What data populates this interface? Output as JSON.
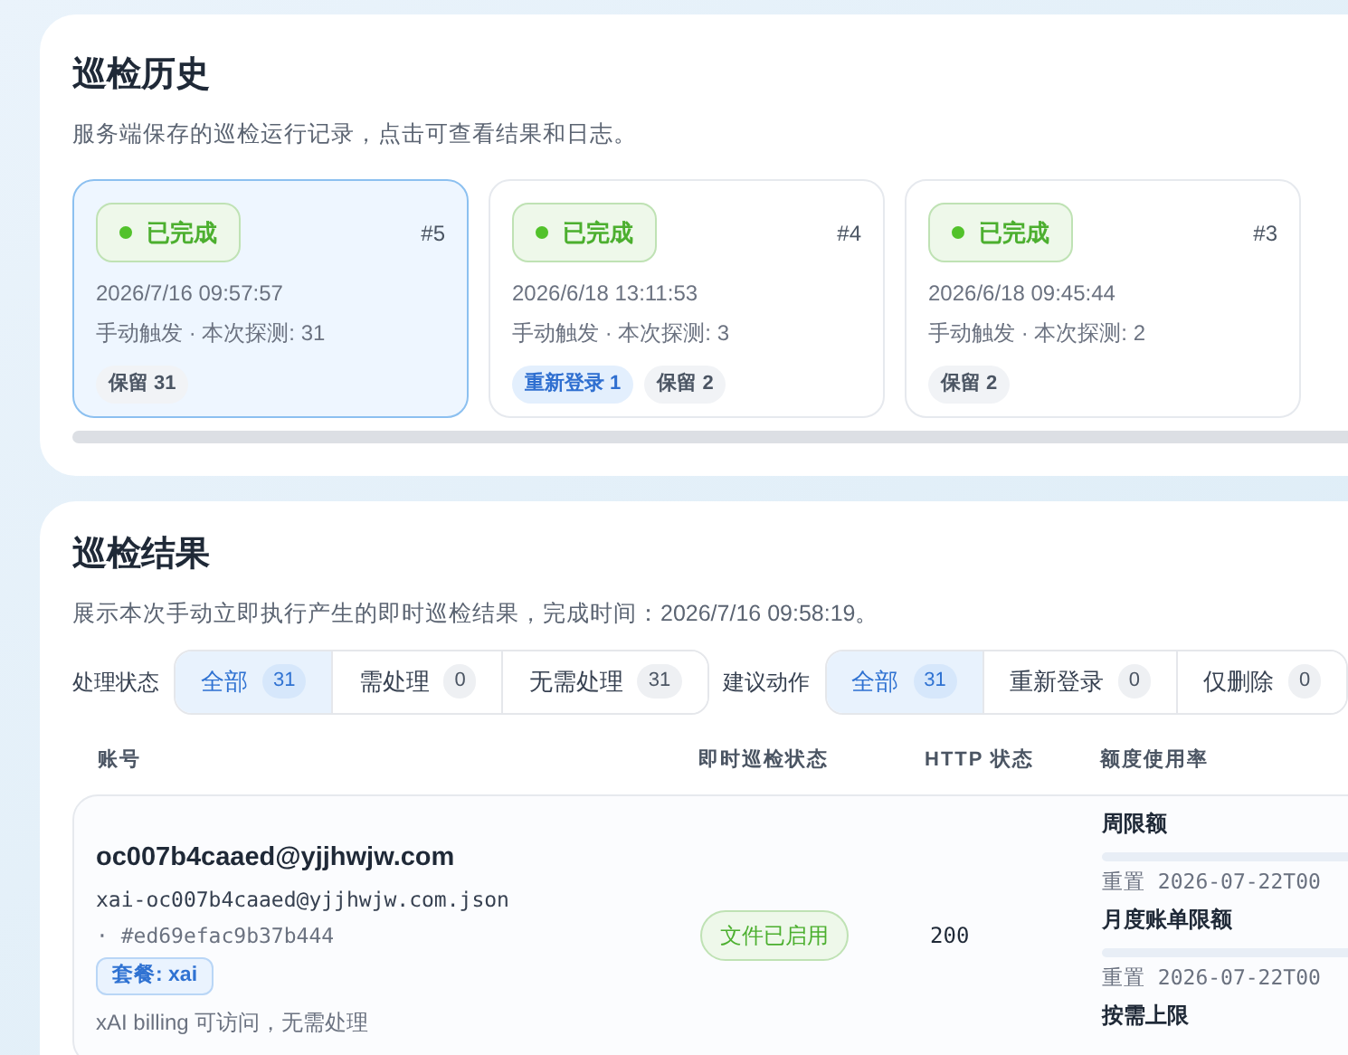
{
  "history": {
    "title": "巡检历史",
    "subtitle": "服务端保存的巡检运行记录，点击可查看结果和日志。",
    "runs": [
      {
        "status": "已完成",
        "number": "#5",
        "time": "2026/7/16 09:57:57",
        "summary": "手动触发 · 本次探测: 31",
        "selected": true,
        "tags": [
          {
            "kind": "keep",
            "label": "保留 31"
          }
        ]
      },
      {
        "status": "已完成",
        "number": "#4",
        "time": "2026/6/18 13:11:53",
        "summary": "手动触发 · 本次探测: 3",
        "selected": false,
        "tags": [
          {
            "kind": "relogin",
            "label": "重新登录 1"
          },
          {
            "kind": "keep",
            "label": "保留 2"
          }
        ]
      },
      {
        "status": "已完成",
        "number": "#3",
        "time": "2026/6/18 09:45:44",
        "summary": "手动触发 · 本次探测: 2",
        "selected": false,
        "tags": [
          {
            "kind": "keep",
            "label": "保留 2"
          }
        ]
      }
    ]
  },
  "results": {
    "title": "巡检结果",
    "subtitle": "展示本次手动立即执行产生的即时巡检结果，完成时间：2026/7/16 09:58:19。",
    "filters": [
      {
        "label": "处理状态",
        "options": [
          {
            "label": "全部",
            "count": "31",
            "selected": true
          },
          {
            "label": "需处理",
            "count": "0",
            "selected": false
          },
          {
            "label": "无需处理",
            "count": "31",
            "selected": false
          }
        ]
      },
      {
        "label": "建议动作",
        "options": [
          {
            "label": "全部",
            "count": "31",
            "selected": true
          },
          {
            "label": "重新登录",
            "count": "0",
            "selected": false
          },
          {
            "label": "仅删除",
            "count": "0",
            "selected": false
          }
        ]
      }
    ],
    "columns": [
      "账号",
      "即时巡检状态",
      "HTTP 状态",
      "额度使用率"
    ],
    "rows": [
      {
        "email": "oc007b4caaed@yjjhwjw.com",
        "file": "xai-oc007b4caaed@yjjhwjw.com.json",
        "hash": "· #ed69efac9b37b444",
        "plan": "套餐: xai",
        "note": "xAI billing 可访问，无需处理",
        "status": "文件已启用",
        "http": "200",
        "quotas": [
          {
            "name": "周限额",
            "reset": "重置 2026-07-22T00"
          },
          {
            "name": "月度账单限额",
            "reset": "重置 2026-07-22T00"
          },
          {
            "name": "按需上限"
          }
        ]
      }
    ]
  }
}
